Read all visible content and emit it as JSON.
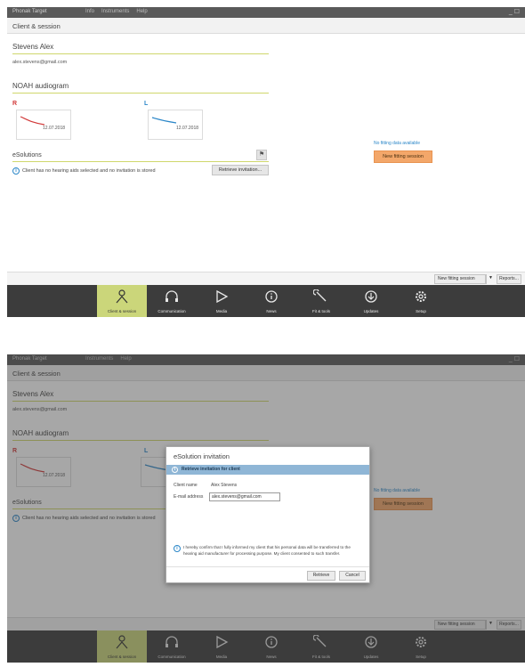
{
  "app": {
    "title": "Phonak Target",
    "menu1": [
      "Info",
      "Instruments",
      "Help"
    ],
    "menu2": [
      "Instruments",
      "Help"
    ],
    "window_controls": "_ ☐"
  },
  "subheader": "Client & session",
  "client": {
    "name": "Stevens Alex",
    "email1": "alex.stevens@gmail.com",
    "email2": "alex.stevens@gmail.com"
  },
  "noah": {
    "title": "NOAH audiogram",
    "right_ear": "R",
    "left_ear": "L",
    "right_date": "12.07.2018",
    "left_date": "12.07.2018"
  },
  "esolutions": {
    "title": "eSolutions",
    "message": "Client has no hearing aids selected and no invitation is stored",
    "retrieve_label": "Retrieve invitation..."
  },
  "fitting": {
    "none_text": "No fitting data available",
    "new_session_label": "New fitting session"
  },
  "statusbar": {
    "split_label": "New fitting session",
    "arrow": "▼",
    "reports_label": "Reports..."
  },
  "nav": [
    {
      "label": "Client & session",
      "icon": "client-icon",
      "active": true
    },
    {
      "label": "Communication",
      "icon": "headset-icon",
      "active": false
    },
    {
      "label": "Media",
      "icon": "play-icon",
      "active": false
    },
    {
      "label": "News",
      "icon": "info-icon",
      "active": false
    },
    {
      "label": "Fit & tools",
      "icon": "tools-icon",
      "active": false
    },
    {
      "label": "Updates",
      "icon": "download-icon",
      "active": false
    },
    {
      "label": "Setup",
      "icon": "gear-icon",
      "active": false
    }
  ],
  "dialog": {
    "title": "eSolution invitation",
    "bar_text": "Retrieve invitation for client",
    "client_name_label": "Client name",
    "client_name_value": "Alex Stevens",
    "email_label": "E-mail address",
    "email_value": "alex.stevens@gmail.com",
    "consent_text": "I hereby confirm that I fully informed my client that his personal data will be transferred to the hearing aid manufacturer for processing purpose. My client consented to such transfer.",
    "retrieve_label": "Retrieve",
    "cancel_label": "Cancel"
  },
  "colors": {
    "accent_green": "#cbd67a",
    "orange_button": "#f3a76a",
    "right_ear": "#d23a3a",
    "left_ear": "#2a86c8",
    "dialog_bar": "#8fb6d6"
  }
}
